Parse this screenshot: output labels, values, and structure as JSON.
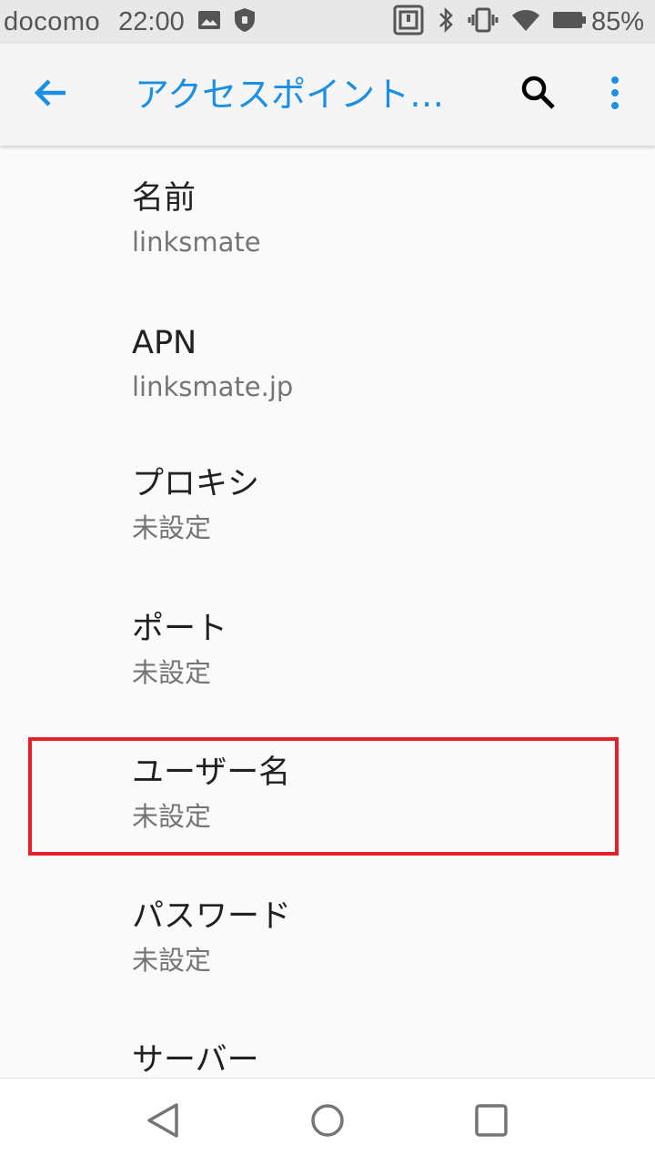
{
  "status_bar": {
    "carrier": "docomo",
    "time": "22:00",
    "battery_percent": "85%",
    "left_icons": [
      "image-icon",
      "shield-icon"
    ],
    "right_icons": [
      "nfc-icon",
      "bluetooth-icon",
      "vibrate-icon",
      "wifi-icon",
      "battery-icon"
    ]
  },
  "app_bar": {
    "title": "アクセスポイント…",
    "back_icon": "arrow-left-icon",
    "search_icon": "search-icon",
    "overflow_icon": "more-vert-icon",
    "accent_color": "#1a8fe3"
  },
  "preferences": [
    {
      "title": "名前",
      "summary": "linksmate"
    },
    {
      "title": "APN",
      "summary": "linksmate.jp"
    },
    {
      "title": "プロキシ",
      "summary": "未設定"
    },
    {
      "title": "ポート",
      "summary": "未設定"
    },
    {
      "title": "ユーザー名",
      "summary": "未設定",
      "highlighted": true
    },
    {
      "title": "パスワード",
      "summary": "未設定"
    },
    {
      "title": "サーバー",
      "summary": ""
    }
  ],
  "highlight_color": "#e3202a",
  "nav_bar": {
    "icons": [
      "back-triangle-icon",
      "home-circle-icon",
      "recents-square-icon"
    ]
  }
}
